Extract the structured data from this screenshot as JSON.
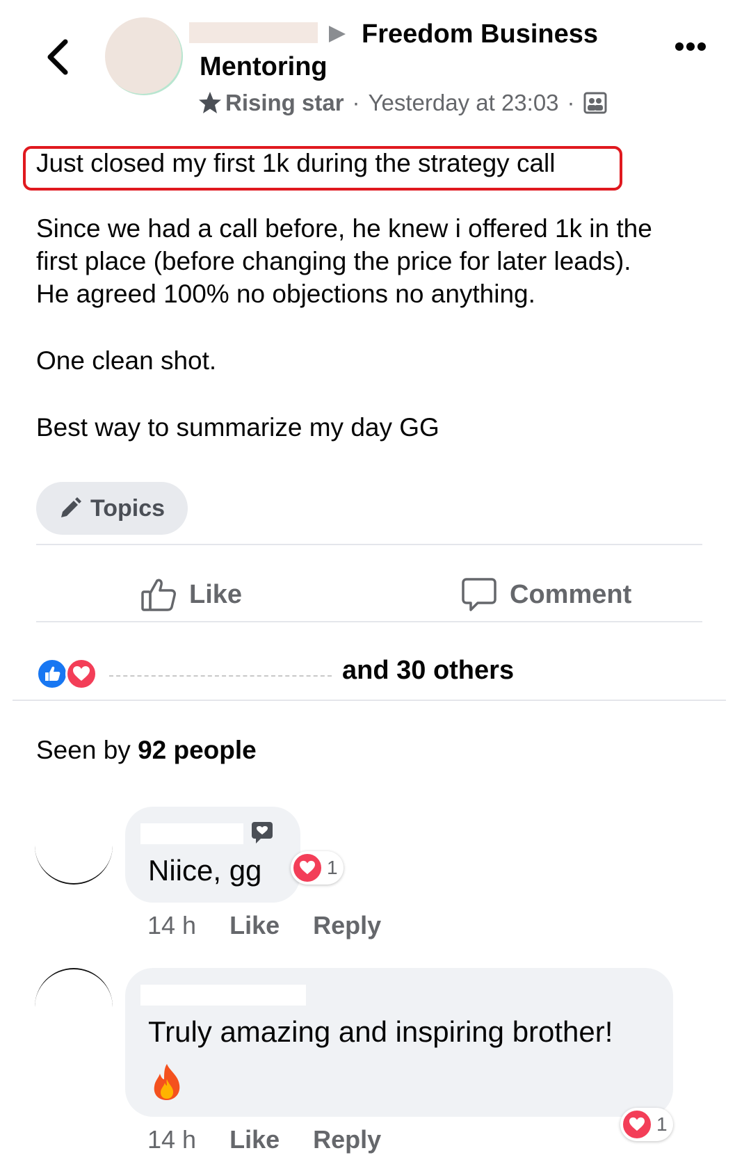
{
  "post": {
    "group_line1": "Freedom Business",
    "group_line2": "Mentoring",
    "badge": "Rising star",
    "separator": "·",
    "timestamp": "Yesterday at 23:03",
    "title": "Just closed my first 1k during the strategy call",
    "body_lines": [
      "Since we had a call before, he knew i offered 1k in the",
      "first place (before changing the price for later leads).",
      "He agreed 100% no objections no anything.",
      "One clean shot.",
      "Best way to summarize my day GG"
    ],
    "topics_label": "Topics"
  },
  "actions": {
    "like_label": "Like",
    "comment_label": "Comment"
  },
  "reactions": {
    "others_text": "and 30 others"
  },
  "seen": {
    "prefix": "Seen by",
    "count_text": "92 people"
  },
  "comments": [
    {
      "text": "Niice, gg",
      "reaction_count": "1",
      "time": "14 h",
      "like_label": "Like",
      "reply_label": "Reply"
    },
    {
      "text": "Truly amazing and inspiring brother!",
      "emoji": "🔥",
      "reaction_count": "1",
      "time": "14 h",
      "like_label": "Like",
      "reply_label": "Reply"
    }
  ],
  "colors": {
    "highlight_border": "#e0191f",
    "like_blue": "#1877f2",
    "love_red": "#f33e58",
    "secondary_text": "#65676b",
    "bubble_bg": "#f0f2f5"
  },
  "icons": [
    "back-chevron-icon",
    "caret-right-icon",
    "more-icon",
    "rising-star-icon",
    "group-members-icon",
    "pencil-icon",
    "thumbs-up-icon",
    "comment-icon",
    "like-reaction-icon",
    "love-reaction-icon",
    "fan-badge-icon",
    "fire-emoji"
  ]
}
